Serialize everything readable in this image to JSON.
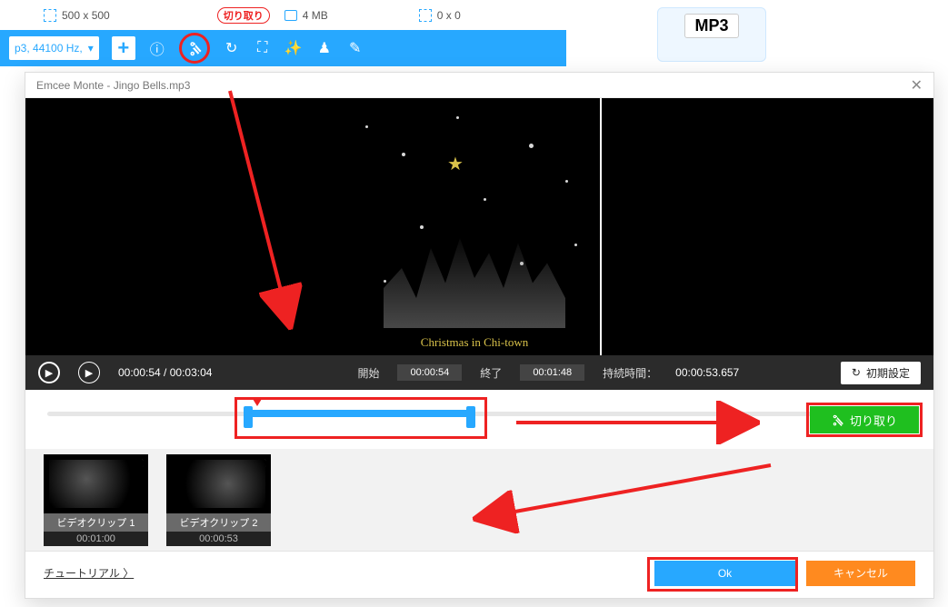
{
  "top": {
    "src_dims": "500 x 500",
    "cut_label": "切り取り",
    "filesize": "4 MB",
    "out_dims": "0 x 0",
    "format": "p3, 44100 Hz,",
    "mp3_badge": "MP3"
  },
  "dialog": {
    "title": "Emcee Monte - Jingo Bells.mp3",
    "art_caption": "Christmas in Chi-town",
    "playback": {
      "pos": "00:00:54",
      "total": "00:03:04"
    },
    "start_label": "開始",
    "start_value": "00:00:54",
    "end_label": "終了",
    "end_value": "00:01:48",
    "duration_label": "持続時間：",
    "duration_value": "00:00:53.657",
    "reset_label": "初期設定",
    "cut_label": "切り取り",
    "clips": [
      {
        "name": "ビデオクリップ 1",
        "dur": "00:01:00"
      },
      {
        "name": "ビデオクリップ 2",
        "dur": "00:00:53"
      }
    ],
    "tutorial": "チュートリアル 〉",
    "ok": "Ok",
    "cancel": "キャンセル"
  }
}
